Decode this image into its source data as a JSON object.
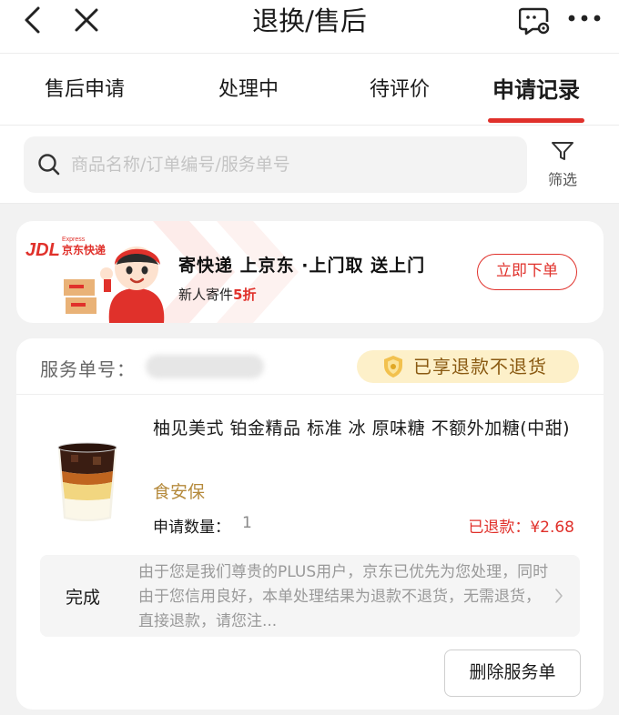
{
  "header": {
    "title": "退换/售后",
    "back_icon": "chevron-left-icon",
    "close_icon": "close-icon",
    "service_icon": "customer-service-settings-icon",
    "more_icon": "more-dots-icon"
  },
  "tabs": [
    {
      "label": "售后申请",
      "active": false
    },
    {
      "label": "处理中",
      "active": false
    },
    {
      "label": "待评价",
      "active": false
    },
    {
      "label": "申请记录",
      "active": true
    }
  ],
  "search": {
    "placeholder": "商品名称/订单编号/服务单号",
    "value": "",
    "filter_label": "筛选"
  },
  "promo": {
    "logo_text": "JDL",
    "logo_sub": "京东快递",
    "logo_small": "Express",
    "title": "寄快递 上京东 ·上门取 送上门",
    "subtitle_prefix": "新人寄件",
    "subtitle_highlight": "5折",
    "button_label": "立即下单"
  },
  "service_card": {
    "service_no_label": "服务单号：",
    "refund_badge": "已享退款不退货",
    "product_name": "柚见美式 铂金精品 标准 冰 原味糖 不额外加糖(中甜)",
    "safety_tag": "食安保",
    "qty_label": "申请数量：",
    "qty_value": "1",
    "refunded_text": "已退款：¥2.68",
    "status": "完成",
    "description": "由于您是我们尊贵的PLUS用户，京东已优先为您处理，同时由于您信用良好，本单处理结果为退款不退货，无需退货，直接退款，请您注...",
    "delete_button": "删除服务单"
  },
  "colors": {
    "accent_red": "#e0312b",
    "badge_bg": "#fdf0c9",
    "badge_text": "#8a5a12",
    "gold_tag": "#b58a3c"
  }
}
